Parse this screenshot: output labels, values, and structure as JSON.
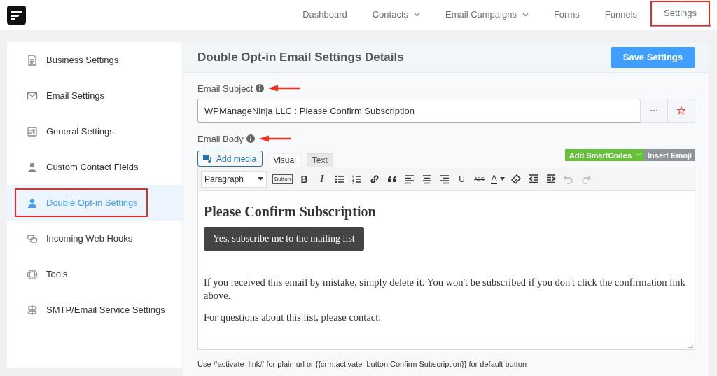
{
  "nav": {
    "items": [
      {
        "label": "Dashboard",
        "dropdown": false,
        "selected": false,
        "highlighted": false
      },
      {
        "label": "Contacts",
        "dropdown": true,
        "selected": false,
        "highlighted": false
      },
      {
        "label": "Email Campaigns",
        "dropdown": true,
        "selected": false,
        "highlighted": false
      },
      {
        "label": "Forms",
        "dropdown": false,
        "selected": false,
        "highlighted": false
      },
      {
        "label": "Funnels",
        "dropdown": false,
        "selected": false,
        "highlighted": false
      },
      {
        "label": "Settings",
        "dropdown": false,
        "selected": true,
        "highlighted": true
      }
    ]
  },
  "sidebar": {
    "items": [
      {
        "label": "Business Settings",
        "selected": false,
        "highlighted": false
      },
      {
        "label": "Email Settings",
        "selected": false,
        "highlighted": false
      },
      {
        "label": "General Settings",
        "selected": false,
        "highlighted": false
      },
      {
        "label": "Custom Contact Fields",
        "selected": false,
        "highlighted": false
      },
      {
        "label": "Double Opt-in Settings",
        "selected": true,
        "highlighted": true
      },
      {
        "label": "Incoming Web Hooks",
        "selected": false,
        "highlighted": false
      },
      {
        "label": "Tools",
        "selected": false,
        "highlighted": false
      },
      {
        "label": "SMTP/Email Service Settings",
        "selected": false,
        "highlighted": false
      }
    ]
  },
  "page": {
    "title": "Double Opt-in Email Settings Details",
    "save_button": "Save Settings"
  },
  "subject": {
    "label": "Email Subject",
    "annotated": true,
    "value": "WPManageNinja LLC : Please Confirm Subscription"
  },
  "body": {
    "label": "Email Body",
    "annotated": true,
    "add_media": "Add media",
    "tabs": [
      {
        "label": "Visual",
        "selected": true
      },
      {
        "label": "Text",
        "selected": false
      }
    ],
    "smartcodes": "Add SmartCodes",
    "emoji": "Insert Emoji",
    "toolbar": [
      {
        "kind": "select",
        "label": "Paragraph",
        "disabled": false
      },
      {
        "kind": "boxed",
        "label": "Button",
        "disabled": false
      },
      {
        "kind": "bold",
        "label": "B",
        "disabled": false
      },
      {
        "kind": "italic",
        "label": "I",
        "disabled": false
      },
      {
        "kind": "bullet-list",
        "disabled": false
      },
      {
        "kind": "number-list",
        "disabled": false
      },
      {
        "kind": "link",
        "disabled": false
      },
      {
        "kind": "quote",
        "disabled": false
      },
      {
        "kind": "align-left",
        "disabled": false
      },
      {
        "kind": "align-center",
        "disabled": false
      },
      {
        "kind": "align-right",
        "disabled": false
      },
      {
        "kind": "underline",
        "label": "U",
        "disabled": false
      },
      {
        "kind": "strike",
        "label": "ABC",
        "disabled": false
      },
      {
        "kind": "color",
        "label": "A",
        "disabled": false
      },
      {
        "kind": "eraser",
        "disabled": false
      },
      {
        "kind": "outdent",
        "disabled": false
      },
      {
        "kind": "indent",
        "disabled": false
      },
      {
        "kind": "undo",
        "disabled": true
      },
      {
        "kind": "redo",
        "disabled": true
      }
    ],
    "content": [
      {
        "kind": "heading",
        "text": "Please Confirm Subscription"
      },
      {
        "kind": "button",
        "text": "Yes, subscribe me to the mailing list"
      },
      {
        "kind": "paragraph",
        "text": "If you received this email by mistake, simply delete it. You won't be subscribed if you don't click the confirmation link above."
      },
      {
        "kind": "paragraph",
        "text": "For questions about this list, please contact:"
      }
    ]
  },
  "hint": "Use #activate_link# for plain url or {{crm.activate_button|Confirm Subscription}} for default button"
}
